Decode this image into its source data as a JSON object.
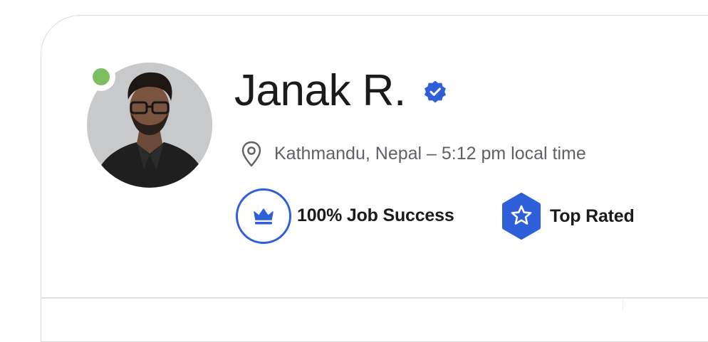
{
  "profile": {
    "name": "Janak R.",
    "verified_icon": "verified-badge-icon",
    "status": "online",
    "status_color": "#7cbf63",
    "location": {
      "icon": "location-pin-icon",
      "text": "Kathmandu, Nepal – 5:12 pm local time"
    },
    "badges": [
      {
        "icon": "crown-icon",
        "label": "100% Job Success",
        "color": "#2f5fd8"
      },
      {
        "icon": "star-badge-icon",
        "label": "Top Rated",
        "color": "#2f5fd8"
      }
    ]
  },
  "colors": {
    "accent": "#2f5fd8",
    "online": "#7cbf63",
    "text_primary": "#1b1b1b",
    "text_secondary": "#5e6168"
  }
}
